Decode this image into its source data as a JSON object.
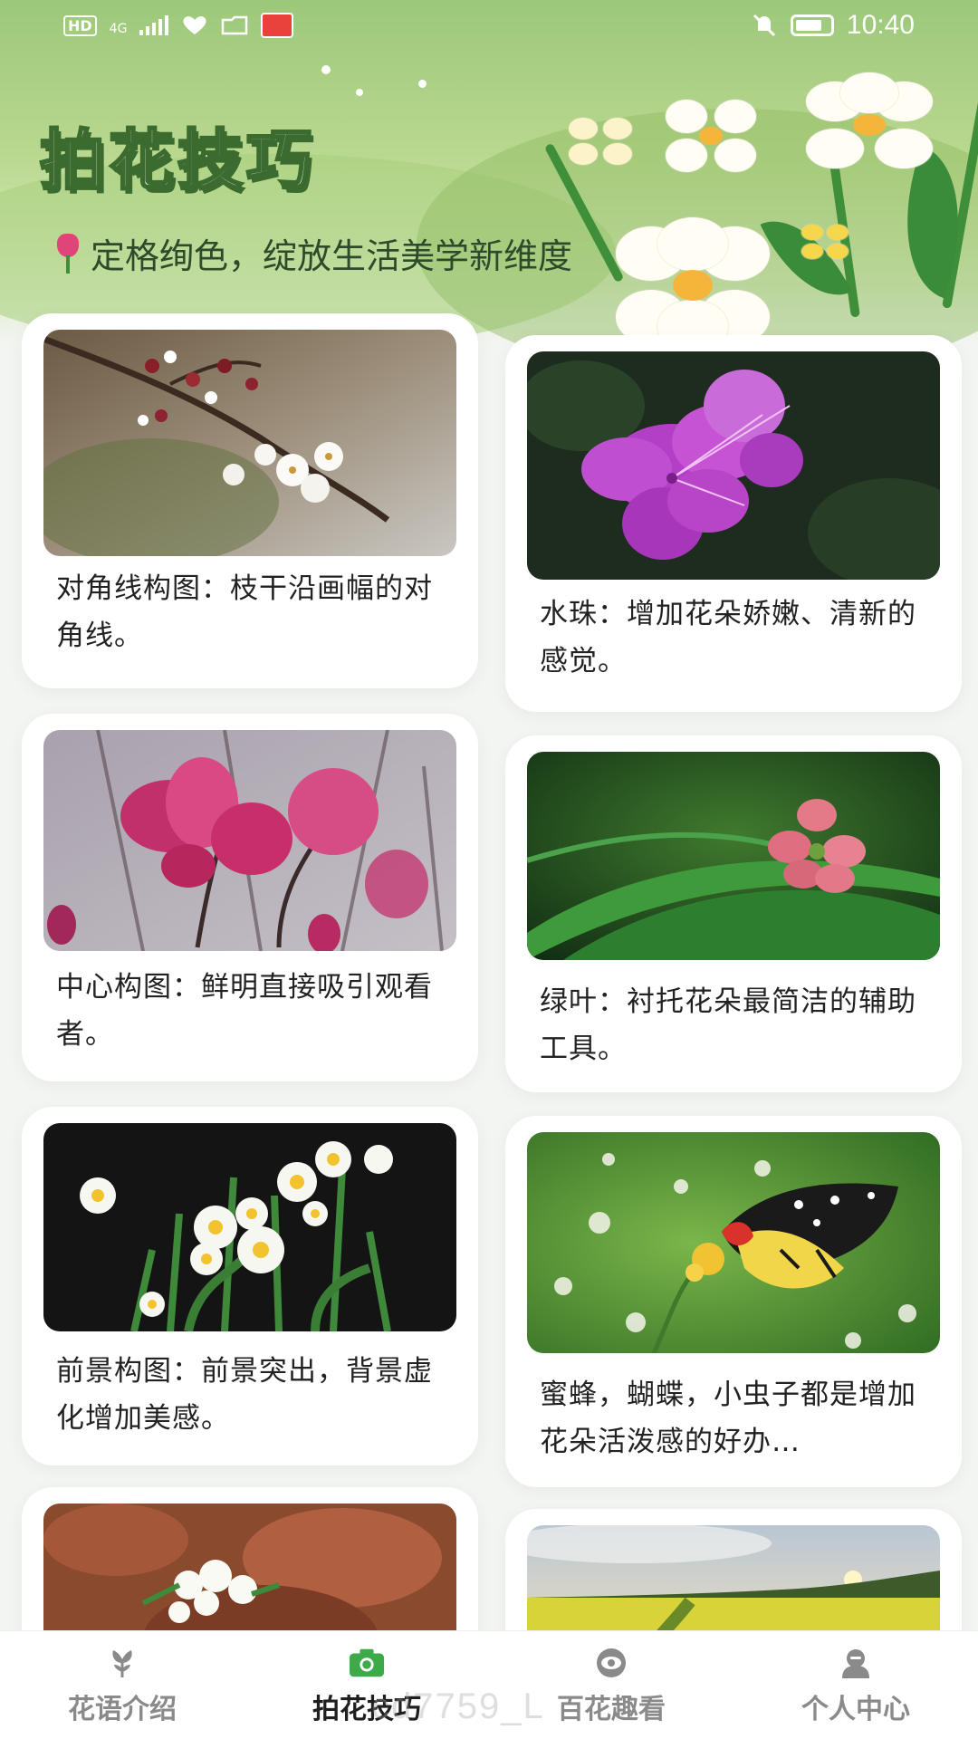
{
  "status_bar": {
    "network": "4G",
    "hd": "HD",
    "time": "10:40"
  },
  "header": {
    "title": "拍花技巧",
    "subtitle": "定格绚色，绽放生活美学新维度"
  },
  "cards": [
    {
      "caption": "对角线构图：枝干沿画幅的对角线。",
      "photo": "plum-blossom-branch"
    },
    {
      "caption": "水珠：增加花朵娇嫩、清新的感觉。",
      "photo": "purple-azalea"
    },
    {
      "caption": "中心构图：鲜明直接吸引观看者。",
      "photo": "pink-magnolia"
    },
    {
      "caption": "绿叶：衬托花朵最简洁的辅助工具。",
      "photo": "pink-flower-on-leaf"
    },
    {
      "caption": "前景构图：前景突出，背景虚化增加美感。",
      "photo": "narcissus"
    },
    {
      "caption": "蜜蜂，蝴蝶，小虫子都是增加花朵活泼感的好办…",
      "photo": "butterfly-on-flowers"
    },
    {
      "caption": "",
      "photo": "white-blossoms-rocks"
    },
    {
      "caption": "",
      "photo": "field-sunset"
    }
  ],
  "nav": {
    "items": [
      {
        "label": "花语介绍",
        "icon": "flower-sprout-icon",
        "active": false
      },
      {
        "label": "拍花技巧",
        "icon": "camera-icon",
        "active": true
      },
      {
        "label": "百花趣看",
        "icon": "eye-icon",
        "active": false
      },
      {
        "label": "个人中心",
        "icon": "person-icon",
        "active": false
      }
    ]
  },
  "watermark": "cd7759_L",
  "colors": {
    "accent_green": "#3daa4a",
    "title_outline": "#3b6b2f",
    "nav_inactive": "#8a8a8a"
  }
}
